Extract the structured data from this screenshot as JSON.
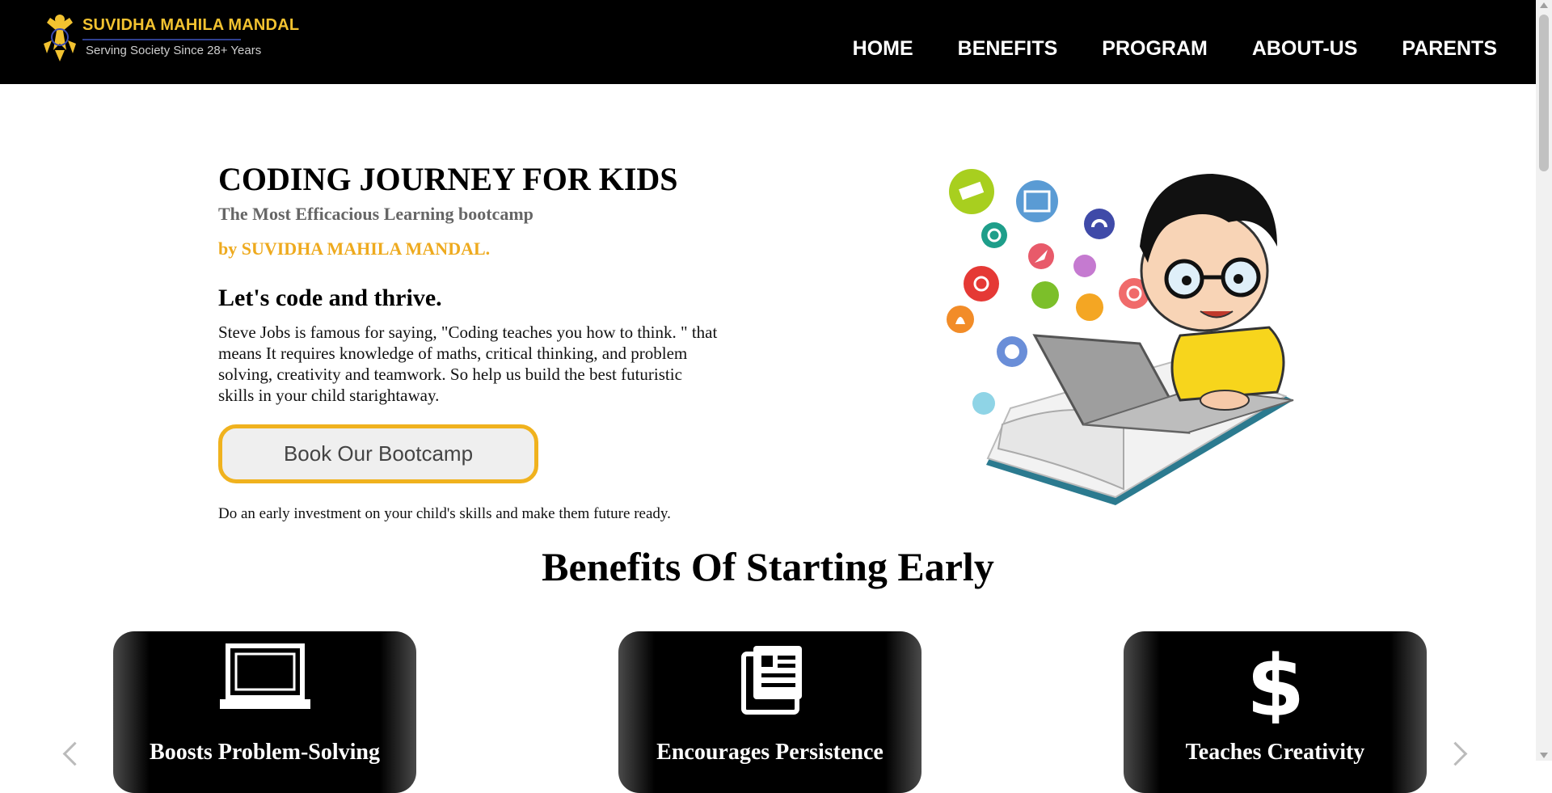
{
  "header": {
    "logo_title": "SUVIDHA MAHILA MANDAL",
    "logo_tagline": "Serving Society Since 28+ Years",
    "nav": [
      "HOME",
      "BENEFITS",
      "PROGRAM",
      "ABOUT-US",
      "PARENTS"
    ]
  },
  "hero": {
    "title": "CODING JOURNEY FOR KIDS",
    "subtitle": "The Most Efficacious Learning bootcamp",
    "by_line": "by SUVIDHA MAHILA MANDAL.",
    "heading": "Let's code and thrive.",
    "paragraph": "Steve Jobs is famous for saying, \"Coding teaches you how to think. \" that means It requires knowledge of maths, critical thinking, and problem solving, creativity and teamwork. So help us build the best futuristic skills in your child starightaway.",
    "cta_label": "Book Our Bootcamp",
    "cta_note": "Do an early investment on your child's skills and make them future ready."
  },
  "benefits": {
    "title": "Benefits Of Starting Early",
    "cards": [
      {
        "label": "Boosts Problem-Solving",
        "icon": "laptop-icon"
      },
      {
        "label": "Encourages Persistence",
        "icon": "newspaper-icon"
      },
      {
        "label": "Teaches Creativity",
        "icon": "dollar-icon"
      }
    ]
  },
  "colors": {
    "header_bg": "#000000",
    "accent": "#f0b21e",
    "logo_gold": "#f2c230"
  }
}
